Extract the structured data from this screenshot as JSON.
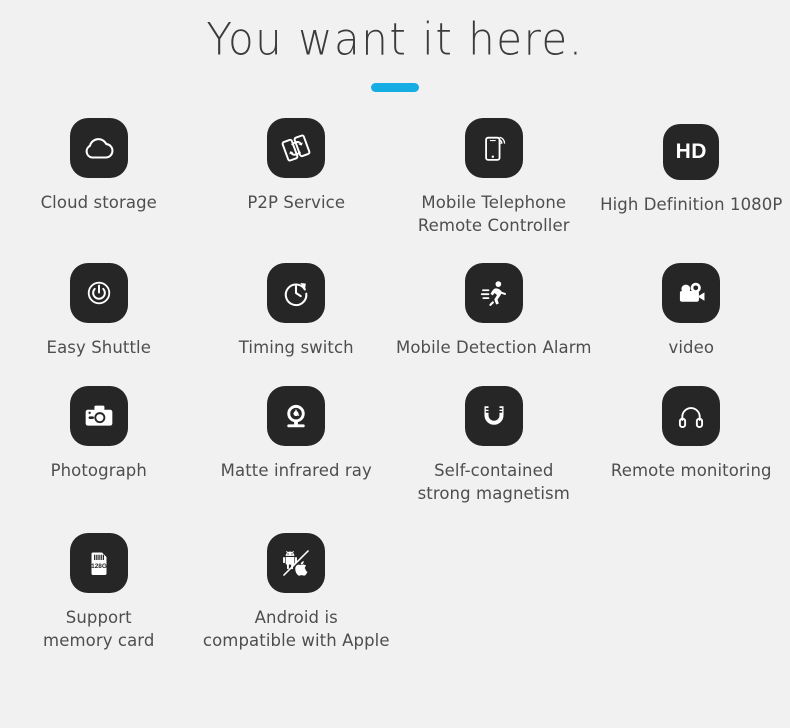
{
  "header": {
    "title": "You want it here.",
    "accent_color": "#16ade4"
  },
  "theme": {
    "background": "#f1f1f1",
    "tile_color": "#262626",
    "glyph_color": "#ffffff",
    "label_color": "#4e4e4e"
  },
  "features": [
    [
      {
        "icon": "cloud-icon",
        "label": "Cloud storage"
      },
      {
        "icon": "p2p-transfer-icon",
        "label": "P2P Service"
      },
      {
        "icon": "mobile-phone-wifi-icon",
        "label": "Mobile Telephone\nRemote Controller"
      },
      {
        "icon": "hd-badge-icon",
        "label": "High Definition 1080P",
        "glyph_text": "HD"
      }
    ],
    [
      {
        "icon": "power-button-icon",
        "label": "Easy Shuttle"
      },
      {
        "icon": "clock-timer-icon",
        "label": "Timing switch"
      },
      {
        "icon": "running-person-icon",
        "label": "Mobile Detection Alarm"
      },
      {
        "icon": "video-camera-icon",
        "label": "video"
      }
    ],
    [
      {
        "icon": "photo-camera-icon",
        "label": "Photograph"
      },
      {
        "icon": "webcam-icon",
        "label": "Matte infrared ray"
      },
      {
        "icon": "magnet-icon",
        "label": "Self-contained\nstrong magnetism"
      },
      {
        "icon": "headphones-icon",
        "label": "Remote monitoring"
      }
    ],
    [
      {
        "icon": "memory-card-icon",
        "label": "Support\nmemory card",
        "glyph_text": "128G"
      },
      {
        "icon": "android-apple-icon",
        "label": "Android is\ncompatible  with Apple"
      }
    ]
  ]
}
